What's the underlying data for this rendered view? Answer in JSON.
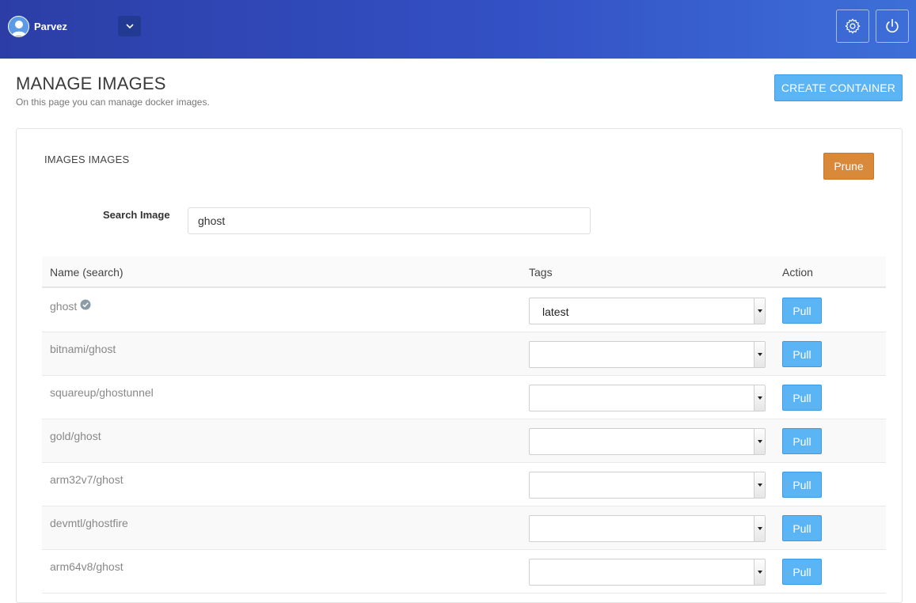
{
  "header": {
    "username": "Parvez",
    "icons": {
      "avatar": "user-avatar-icon",
      "dropdown": "chevron-down-icon",
      "settings": "gear-icon",
      "power": "power-icon"
    },
    "colors": {
      "bar_start": "#2c3ea6",
      "bar_end": "#3d6fd8"
    }
  },
  "page": {
    "title": "MANAGE IMAGES",
    "subtitle": "On this page you can manage docker images.",
    "create_label": "CREATE CONTAINER"
  },
  "panel": {
    "title": "IMAGES IMAGES",
    "prune_label": "Prune"
  },
  "search": {
    "label": "Search Image",
    "value": "ghost"
  },
  "table": {
    "columns": {
      "name": "Name (search)",
      "tags": "Tags",
      "action": "Action"
    },
    "pull_label": "Pull",
    "rows": [
      {
        "name": "ghost",
        "verified": true,
        "tag": "latest"
      },
      {
        "name": "bitnami/ghost",
        "verified": false,
        "tag": ""
      },
      {
        "name": "squareup/ghostunnel",
        "verified": false,
        "tag": ""
      },
      {
        "name": "gold/ghost",
        "verified": false,
        "tag": ""
      },
      {
        "name": "arm32v7/ghost",
        "verified": false,
        "tag": ""
      },
      {
        "name": "devmtl/ghostfire",
        "verified": false,
        "tag": ""
      },
      {
        "name": "arm64v8/ghost",
        "verified": false,
        "tag": ""
      }
    ]
  }
}
